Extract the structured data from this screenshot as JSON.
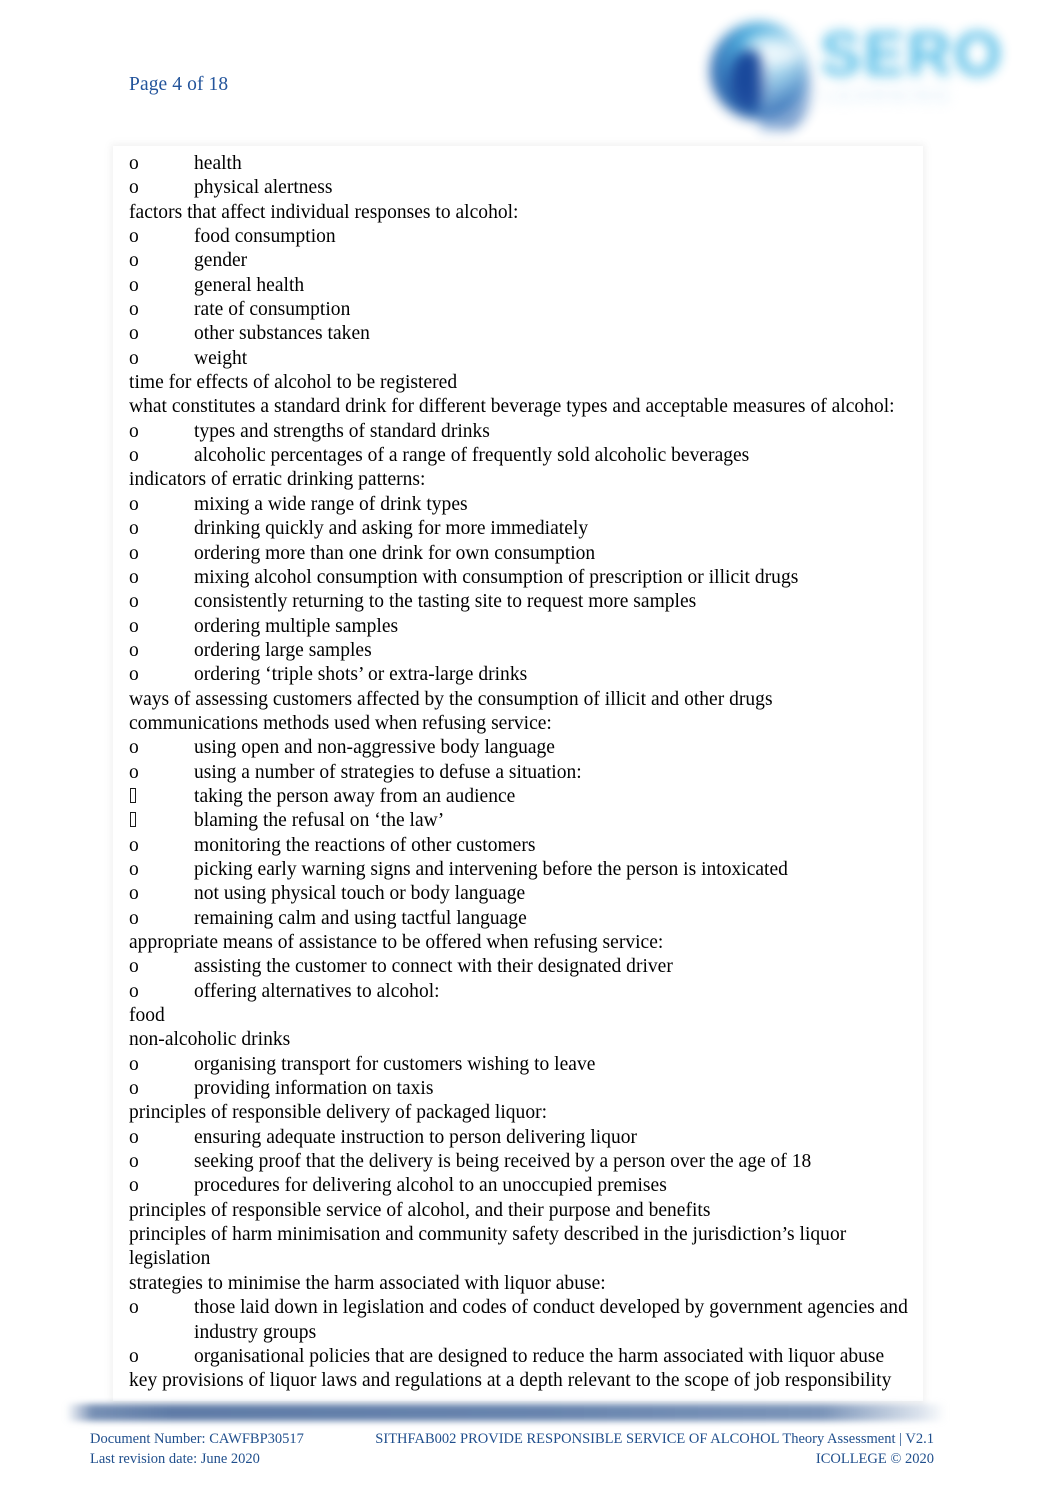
{
  "header": {
    "page_label": "Page 4 of 18",
    "page_color": "#23549b",
    "logo": {
      "name": "sero-logo",
      "wordmark": "SERO",
      "tagline": "LEARNING",
      "globe_dark_blue": "#17479c",
      "globe_light_blue": "#49a9db",
      "wordmark_color": "#4fbbe6"
    }
  },
  "document": {
    "lines": [
      {
        "bullet": "o",
        "text": "health"
      },
      {
        "bullet": "o",
        "text": "physical alertness"
      },
      {
        "bullet": "",
        "text": "factors that affect individual responses to alcohol:"
      },
      {
        "bullet": "o",
        "text": "food consumption"
      },
      {
        "bullet": "o",
        "text": "gender"
      },
      {
        "bullet": "o",
        "text": "general health"
      },
      {
        "bullet": "o",
        "text": "rate of consumption"
      },
      {
        "bullet": "o",
        "text": "other substances taken"
      },
      {
        "bullet": "o",
        "text": "weight"
      },
      {
        "bullet": "",
        "text": "time for effects of alcohol to be registered"
      },
      {
        "bullet": "",
        "text": "what constitutes a standard drink for different beverage types and acceptable measures of alcohol:"
      },
      {
        "bullet": "o",
        "text": "types and strengths of standard drinks"
      },
      {
        "bullet": "o",
        "text": "alcoholic percentages of a range of frequently sold alcoholic beverages"
      },
      {
        "bullet": "",
        "text": "indicators of erratic drinking patterns:"
      },
      {
        "bullet": "o",
        "text": "mixing a wide range of drink types"
      },
      {
        "bullet": "o",
        "text": "drinking quickly and asking for more immediately"
      },
      {
        "bullet": "o",
        "text": "ordering more than one drink for own consumption"
      },
      {
        "bullet": "o",
        "text": "mixing alcohol consumption with consumption of prescription or illicit drugs"
      },
      {
        "bullet": "o",
        "text": "consistently returning to the tasting site to request more samples"
      },
      {
        "bullet": "o",
        "text": "ordering multiple samples"
      },
      {
        "bullet": "o",
        "text": "ordering large samples"
      },
      {
        "bullet": "o",
        "text": "ordering ‘triple shots’ or extra-large drinks"
      },
      {
        "bullet": "",
        "text": "ways of assessing customers affected by the consumption of illicit and other drugs"
      },
      {
        "bullet": "",
        "text": "communications methods used when refusing service:"
      },
      {
        "bullet": "o",
        "text": "using open and non-aggressive body language"
      },
      {
        "bullet": "o",
        "text": "using a number of strategies to defuse a situation:"
      },
      {
        "bullet": "tofu",
        "text": "taking the person away from an audience"
      },
      {
        "bullet": "tofu",
        "text": "blaming the refusal on ‘the law’"
      },
      {
        "bullet": "o",
        "text": "monitoring the reactions of other customers"
      },
      {
        "bullet": "o",
        "text": "picking early warning signs and intervening before the person is intoxicated"
      },
      {
        "bullet": "o",
        "text": "not using physical touch or body language"
      },
      {
        "bullet": "o",
        "text": "remaining calm and using tactful language"
      },
      {
        "bullet": "",
        "text": "appropriate means of assistance to be offered when refusing service:"
      },
      {
        "bullet": "o",
        "text": "assisting the customer to connect with their designated driver"
      },
      {
        "bullet": "o",
        "text": "offering alternatives to alcohol:"
      },
      {
        "bullet": "",
        "text": "food"
      },
      {
        "bullet": "",
        "text": "non-alcoholic drinks"
      },
      {
        "bullet": "o",
        "text": "organising transport for customers wishing to leave"
      },
      {
        "bullet": "o",
        "text": "providing information on taxis"
      },
      {
        "bullet": "",
        "text": "principles of responsible delivery of packaged liquor:"
      },
      {
        "bullet": "o",
        "text": "ensuring adequate instruction to person delivering liquor"
      },
      {
        "bullet": "o",
        "text": "seeking proof that the delivery is being received by a person over the age of 18"
      },
      {
        "bullet": "o",
        "text": "procedures for delivering alcohol to an unoccupied premises"
      },
      {
        "bullet": "",
        "text": "principles of responsible service of alcohol, and their purpose and benefits"
      },
      {
        "bullet": "",
        "text": "principles of harm minimisation and community safety described in the jurisdiction’s liquor legislation"
      },
      {
        "bullet": "",
        "text": "strategies to minimise the harm associated with liquor abuse:"
      },
      {
        "bullet": "o",
        "text": "those laid down in legislation and codes of conduct developed by government agencies and industry groups",
        "hanging": false
      },
      {
        "bullet": "o",
        "text": "organisational policies that are designed to reduce the harm associated with liquor abuse"
      },
      {
        "bullet": "",
        "text": "key provisions of liquor laws and regulations at a depth relevant to the scope of job responsibility"
      }
    ]
  },
  "footer": {
    "text_color": "#1f4e8c",
    "left": {
      "document_number": "Document Number:  CAWFBP30517",
      "last_revision": "Last revision date: June 2020"
    },
    "right": {
      "unit_title": "SITHFAB002 PROVIDE RESPONSIBLE SERVICE OF ALCOHOL Theory Assessment | V2.1",
      "copyright": "ICOLLEGE © 2020"
    }
  }
}
